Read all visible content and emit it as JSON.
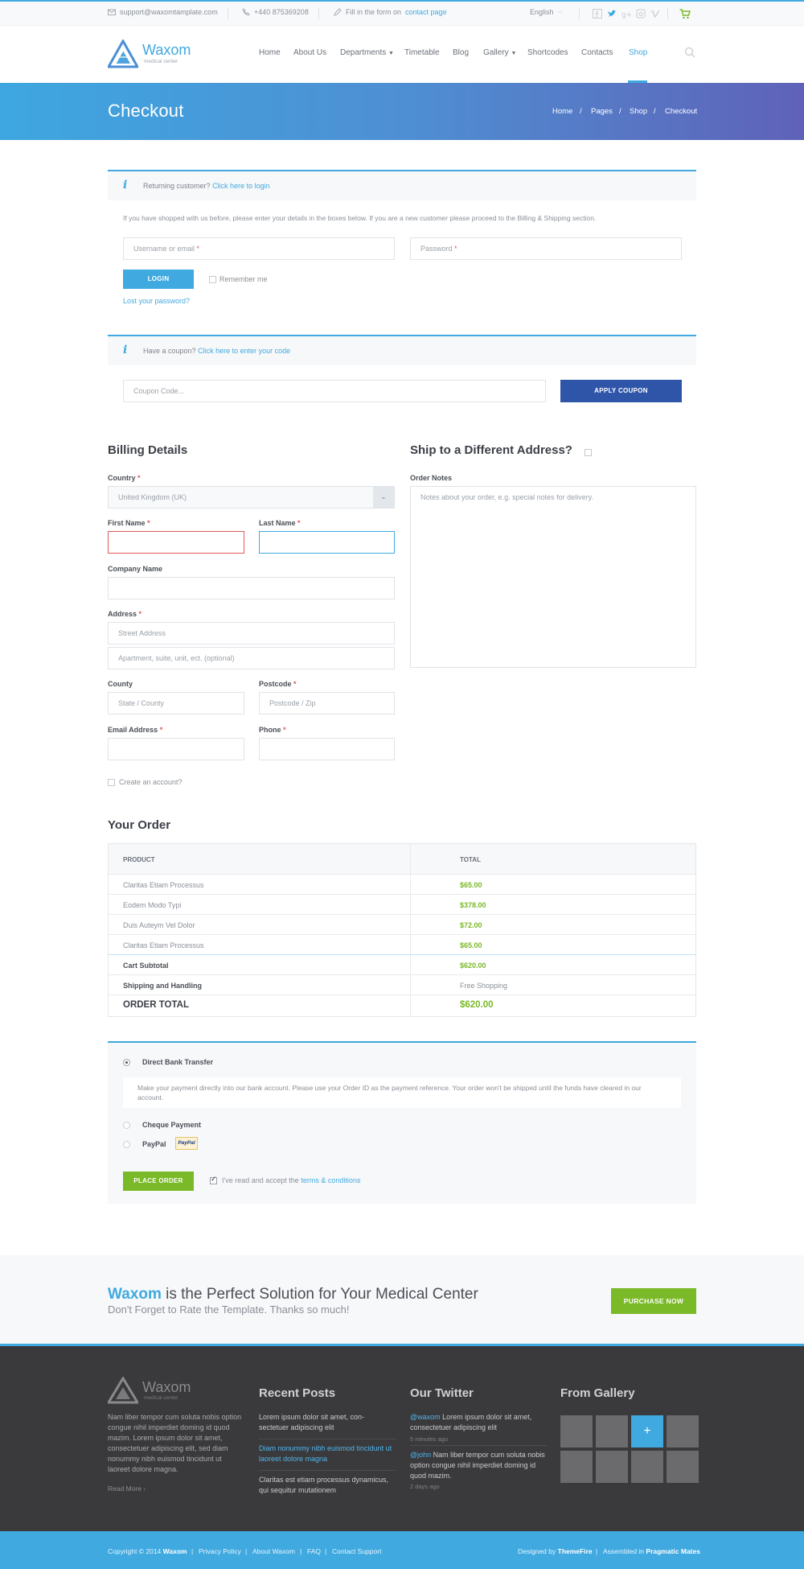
{
  "topbar": {
    "email": "support@waxomtamplate.com",
    "phone": "+440 875369208",
    "fill_prefix": "Fill in the form on",
    "fill_link": "contact page",
    "language": "English"
  },
  "header": {
    "logo_name": "Waxom",
    "logo_tagline": "medical center",
    "nav": [
      "Home",
      "About Us",
      "Departments",
      "Timetable",
      "Blog",
      "Gallery",
      "Shortcodes",
      "Contacts",
      "Shop"
    ],
    "active_nav": "Shop"
  },
  "hero": {
    "title": "Checkout",
    "breadcrumb": [
      "Home",
      "Pages",
      "Shop",
      "Checkout"
    ],
    "separator": "/"
  },
  "login_notice": {
    "text": "Returning customer?",
    "link": "Click here to login",
    "description": "If you have shopped with us before, please enter your details in the boxes below. If you are a new customer please proceed to the Billing & Shipping section.",
    "username_placeholder": "Username or email",
    "password_placeholder": "Password",
    "required_mark": "*",
    "login_button": "LOGIN",
    "remember_label": "Remember me",
    "lost_password": "Lost your password?"
  },
  "coupon_notice": {
    "text": "Have a coupon?",
    "link": "Click here to enter your code",
    "coupon_placeholder": "Coupon Code...",
    "apply_button": "APPLY COUPON"
  },
  "billing": {
    "title": "Billing Details",
    "country_label": "Country",
    "country_value": "United Kingdom (UK)",
    "first_name_label": "First Name",
    "last_name_label": "Last Name",
    "company_label": "Company Name",
    "address_label": "Address",
    "street_placeholder": "Street Address",
    "apartment_placeholder": "Apartment, suite, unit, ect. (optional)",
    "county_label": "County",
    "county_placeholder": "State / County",
    "postcode_label": "Postcode",
    "postcode_placeholder": "Postcode / Zip",
    "email_label": "Email Address",
    "phone_label": "Phone",
    "create_account": "Create an account?"
  },
  "shipping": {
    "title": "Ship to a Different Address?",
    "notes_label": "Order Notes",
    "notes_placeholder": "Notes about your order, e.g. special notes for delivery."
  },
  "order": {
    "title": "Your Order",
    "col_product": "PRODUCT",
    "col_total": "TOTAL",
    "items": [
      {
        "name": "Claritas Etiam Processus",
        "total": "$65.00"
      },
      {
        "name": "Eodem Modo Typi",
        "total": "$378.00"
      },
      {
        "name": "Duis Auteym Vel Dolor",
        "total": "$72.00"
      },
      {
        "name": "Claritas Etiam Processus",
        "total": "$65.00"
      }
    ],
    "subtotal_label": "Cart Subtotal",
    "subtotal_value": "$620.00",
    "shipping_label": "Shipping and Handling",
    "shipping_value": "Free Shopping",
    "total_label": "ORDER TOTAL",
    "total_value": "$620.00"
  },
  "payment": {
    "bank_label": "Direct Bank Transfer",
    "bank_desc": "Make your payment directly into our bank account. Please use your Order ID as the payment reference. Your order won't be shipped until the funds have cleared in our account.",
    "cheque_label": "Cheque Payment",
    "paypal_label": "PayPal",
    "paypal_badge": "PayPal",
    "place_order": "PLACE ORDER",
    "terms_prefix": "I've read and accept the",
    "terms_link": "terms & conditions"
  },
  "promo": {
    "brand": "Waxom",
    "headline": "is the Perfect Solution for Your Medical Center",
    "subline": "Don't Forget to Rate the Template. Thanks so much!",
    "button": "PURCHASE NOW"
  },
  "footer": {
    "logo_name": "Waxom",
    "logo_tagline": "medical center",
    "about": "Nam liber tempor cum soluta nobis option congue nihil imperdiet doming id quod mazim. Lorem ipsum dolor sit amet, consectetuer adipiscing elit, sed diam nonummy nibh euismod tincidunt ut laoreet dolore magna.",
    "read_more": "Read More",
    "recent_title": "Recent Posts",
    "posts": [
      "Lorem ipsum dolor sit amet, con- sectetuer adipiscing elit",
      "Diam nonummy nibh euismod tincidunt ut laoreet dolore magna",
      "Claritas est etiam processus dynamicus, qui sequitur mutationem"
    ],
    "twitter_title": "Our Twitter",
    "tweets": [
      {
        "handle": "@waxom",
        "text": "Lorem ipsum dolor sit amet, consectetuer adipiscing elit",
        "time": "5 minutes ago"
      },
      {
        "handle": "@john",
        "text": "Nam liber tempor cum soluta nobis option congue nihil imperdiet doming id quod mazim.",
        "time": "2 days ago"
      }
    ],
    "gallery_title": "From Gallery",
    "gallery_plus": "+"
  },
  "bottombar": {
    "copyright_prefix": "Copyright © 2014",
    "copyright_brand": "Waxom",
    "links": [
      "Privacy Policy",
      "About Waxom",
      "FAQ",
      "Contact Support"
    ],
    "designed_prefix": "Designed by",
    "designed_by": "ThemeFire",
    "assembled_prefix": "Assembled in",
    "assembled_by": "Pragmatic Mates",
    "separator": "|"
  },
  "colors": {
    "accent": "#3fa9e0",
    "green": "#7ab927",
    "navy": "#2f55a8",
    "dark": "#3a3a3c"
  }
}
